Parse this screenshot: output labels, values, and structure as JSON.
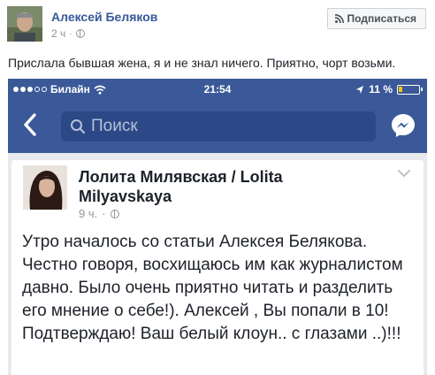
{
  "post": {
    "author": "Алексей Беляков",
    "time": "2 ч",
    "dot": "·",
    "subscribe_label": "Подписаться",
    "text": "Прислала бывшая жена, я и не знал ничего. Приятно, чорт возьми."
  },
  "screenshot": {
    "status": {
      "carrier": "Билайн",
      "time": "21:54",
      "battery": "11 %"
    },
    "search": {
      "placeholder": "Поиск"
    },
    "card": {
      "author": "Лолита Милявская / Lolita Milyavskaya",
      "time": "9 ч.",
      "dot": "·",
      "text": "Утро началось со статьи Алексея Белякова. Честно говоря, восхищаюсь им как журналистом давно. Было очень приятно читать и разделить его мнение о себе!). Алексей , Вы попали в 10! Подтверждаю! Ваш белый клоун.. с глазами ..)!!!"
    },
    "colors": {
      "facebook_blue": "#3b5998",
      "link_blue": "#365899"
    }
  }
}
